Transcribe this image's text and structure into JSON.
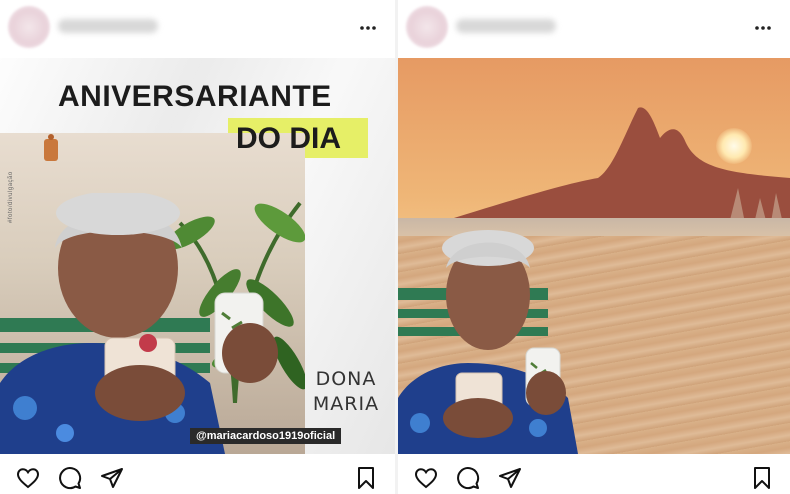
{
  "left_post": {
    "username": "",
    "headline_line1": "ANIVERSARIANTE",
    "headline_line2": "DO DIA",
    "side_credit": "#foto/divulgação",
    "name_line1": "DONA",
    "name_line2": "MARIA",
    "handle": "@mariacardoso1919oficial",
    "accent_color": "#e6ef67",
    "icons": [
      "more-icon",
      "heart-icon",
      "comment-icon",
      "share-icon",
      "bookmark-icon"
    ]
  },
  "right_post": {
    "username": "",
    "icons": [
      "more-icon",
      "heart-icon",
      "comment-icon",
      "share-icon",
      "bookmark-icon"
    ]
  }
}
